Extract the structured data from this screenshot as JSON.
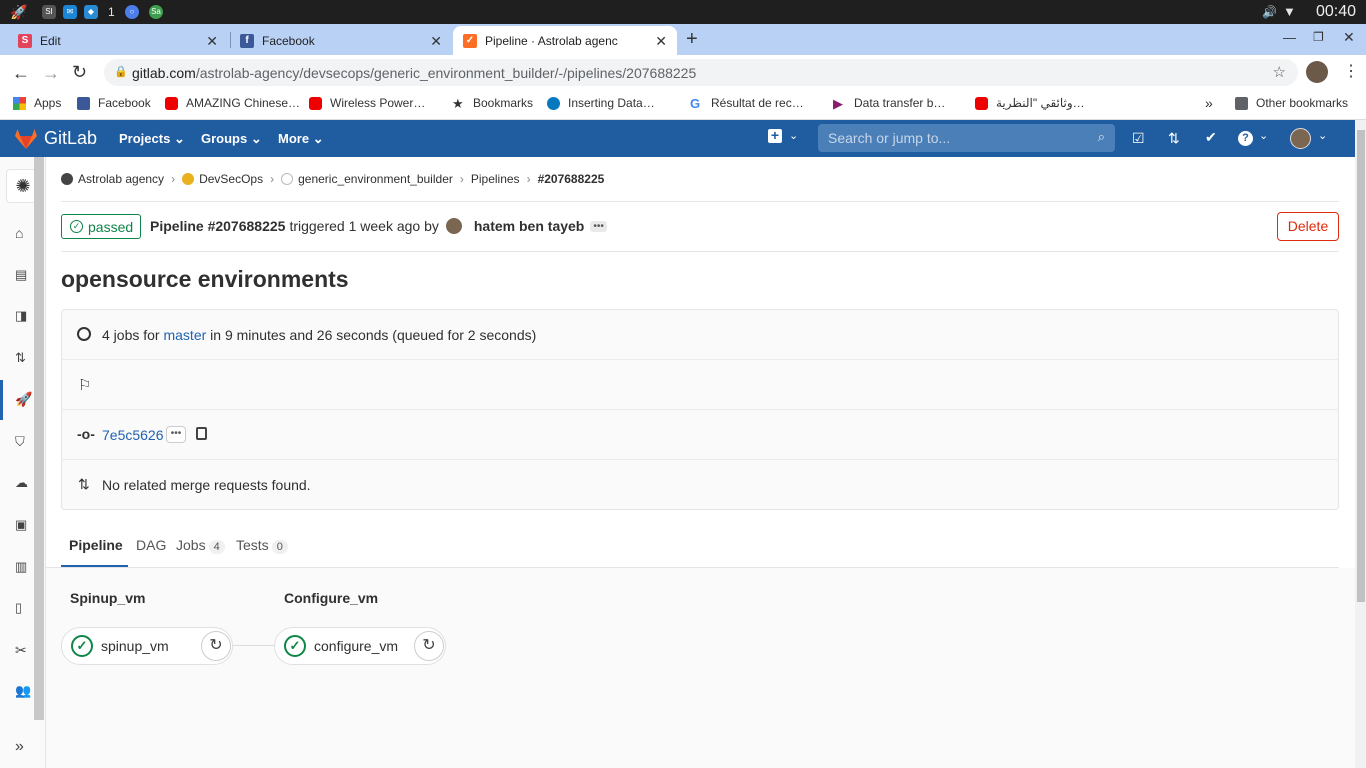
{
  "os": {
    "clock": "00:40",
    "badge_number": "1"
  },
  "tabs": [
    {
      "title": "Edit",
      "icon": "s-favicon"
    },
    {
      "title": "Facebook",
      "icon": "facebook-favicon"
    },
    {
      "title": "Pipeline · Astrolab agenc",
      "icon": "gitlab-favicon"
    }
  ],
  "address": {
    "url_domain": "gitlab.com",
    "url_path": "/astrolab-agency/devsecops/generic_environment_builder/-/pipelines/207688225"
  },
  "bookmarks": [
    {
      "label": "Apps"
    },
    {
      "label": "Facebook"
    },
    {
      "label": "AMAZING Chinese…"
    },
    {
      "label": "Wireless Power…"
    },
    {
      "label": "Bookmarks"
    },
    {
      "label": "Inserting Data…"
    },
    {
      "label": "Résultat de rec…"
    },
    {
      "label": "Data transfer b…"
    },
    {
      "label": "وثائقي \"النظرية…"
    }
  ],
  "bookmarks_other": "Other bookmarks",
  "gitlab": {
    "brand": "GitLab",
    "nav": [
      "Projects",
      "Groups",
      "More"
    ],
    "search_placeholder": "Search or jump to..."
  },
  "breadcrumb": [
    "Astrolab agency",
    "DevSecOps",
    "generic_environment_builder",
    "Pipelines",
    "#207688225"
  ],
  "pipeline": {
    "status": "passed",
    "title_strong": "Pipeline #207688225",
    "triggered_text": "triggered 1 week ago by",
    "user": "hatem ben tayeb",
    "delete_label": "Delete",
    "name": "opensource environments",
    "jobs_prefix": "4 jobs for",
    "branch": "master",
    "jobs_suffix": "in 9 minutes and 26 seconds (queued for 2 seconds)",
    "commit": "7e5c5626",
    "mr_text": "No related merge requests found."
  },
  "subtabs": [
    {
      "label": "Pipeline",
      "count": ""
    },
    {
      "label": "DAG",
      "count": ""
    },
    {
      "label": "Jobs",
      "count": "4"
    },
    {
      "label": "Tests",
      "count": "0"
    }
  ],
  "stages": [
    {
      "name": "Spinup_vm",
      "job": "spinup_vm"
    },
    {
      "name": "Configure_vm",
      "job": "configure_vm"
    }
  ],
  "colors": {
    "header": "#1f5ca0",
    "success": "#108548",
    "danger": "#dd2b0e",
    "link": "#1f63b1"
  }
}
